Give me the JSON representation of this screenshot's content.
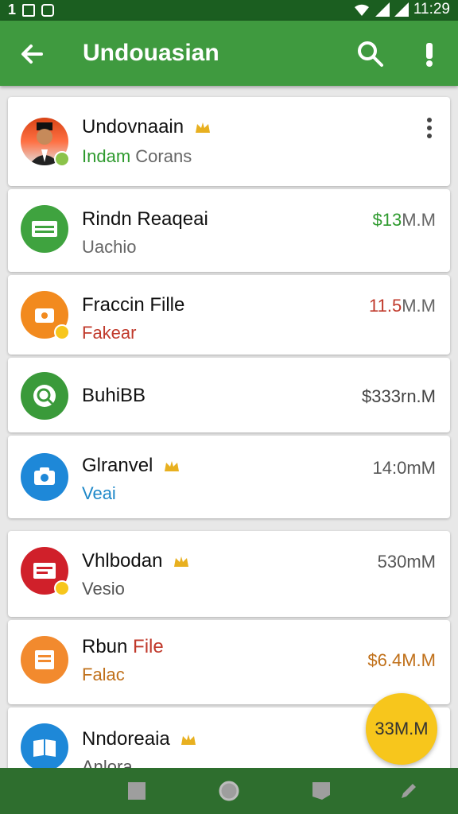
{
  "status_bar": {
    "time": "11:29",
    "left_icons": [
      "notification-icon",
      "sim-icon",
      "image-icon"
    ]
  },
  "app_bar": {
    "title": "Undouasian",
    "actions": [
      "search-icon",
      "more-icon"
    ]
  },
  "colors": {
    "app_bar": "#3f9a3f",
    "status_bar": "#1b5e20",
    "nav_bar": "#2e6e2e",
    "fab": "#f7c61c",
    "green_text": "#2e9a2e",
    "red_text": "#c0392b",
    "blue_text": "#1e88c8",
    "orange_text": "#c0701a"
  },
  "items": [
    {
      "title": "Undovnaain",
      "subtitle_a": "Indam",
      "subtitle_b": "Corans",
      "value": ""
    },
    {
      "title": "Rindn Reaqeai",
      "subtitle": "Uachio",
      "value_a": "$13",
      "value_b": "M.M"
    },
    {
      "title": "Fraccin Fille",
      "subtitle": "Fakear",
      "value_a": "11.5",
      "value_b": "M.M"
    },
    {
      "title": "BuhiBB",
      "subtitle": "",
      "value": "$333rn.M"
    },
    {
      "title": "Glranvel",
      "subtitle": "Veai",
      "value": "14:0mM"
    },
    {
      "title": "Vhlbodan",
      "subtitle": "Vesio",
      "value": "530mM"
    },
    {
      "title_a": "Rbun",
      "title_b": "File",
      "subtitle": "Falac",
      "value": "$6.4M.M"
    },
    {
      "title": "Nndoreaia",
      "subtitle": "Anlora",
      "value": "33M.M"
    }
  ],
  "fab_label": "33M.M",
  "nav_bar": [
    "square-icon",
    "circle-icon",
    "flag-icon",
    "edit-icon"
  ]
}
